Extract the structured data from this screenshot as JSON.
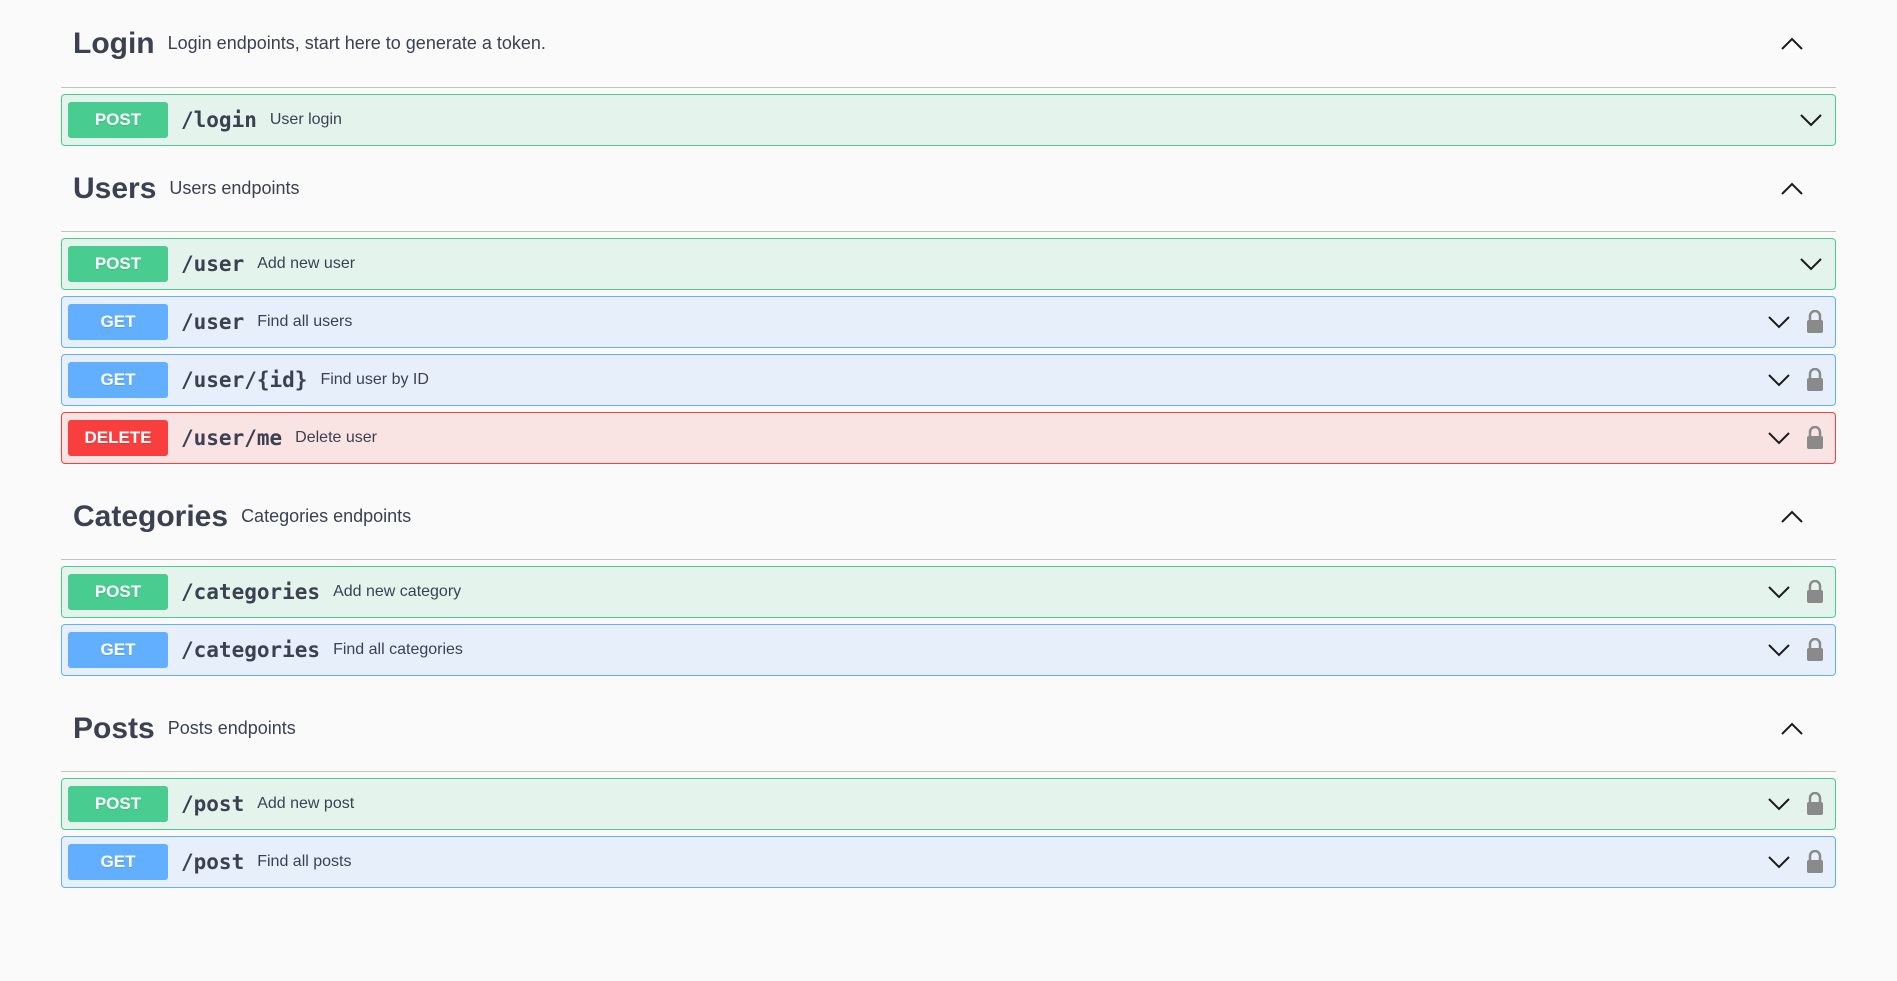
{
  "sections": [
    {
      "name": "Login",
      "description": "Login endpoints, start here to generate a token.",
      "operations": [
        {
          "method": "POST",
          "path": "/login",
          "summary": "User login",
          "locked": false
        }
      ]
    },
    {
      "name": "Users",
      "description": "Users endpoints",
      "operations": [
        {
          "method": "POST",
          "path": "/user",
          "summary": "Add new user",
          "locked": false
        },
        {
          "method": "GET",
          "path": "/user",
          "summary": "Find all users",
          "locked": true
        },
        {
          "method": "GET",
          "path": "/user/{id}",
          "summary": "Find user by ID",
          "locked": true
        },
        {
          "method": "DELETE",
          "path": "/user/me",
          "summary": "Delete user",
          "locked": true
        }
      ]
    },
    {
      "name": "Categories",
      "description": "Categories endpoints",
      "operations": [
        {
          "method": "POST",
          "path": "/categories",
          "summary": "Add new category",
          "locked": true
        },
        {
          "method": "GET",
          "path": "/categories",
          "summary": "Find all categories",
          "locked": true
        }
      ]
    },
    {
      "name": "Posts",
      "description": "Posts endpoints",
      "operations": [
        {
          "method": "POST",
          "path": "/post",
          "summary": "Add new post",
          "locked": true
        },
        {
          "method": "GET",
          "path": "/post",
          "summary": "Find all posts",
          "locked": true
        }
      ]
    }
  ],
  "colors": {
    "post": "#49cc90",
    "get": "#61affe",
    "delete": "#f93e3e",
    "text": "#3b4151",
    "lock": "#8a8a8a"
  },
  "icons": {
    "section_toggle": "chevron-up-icon",
    "operation_toggle": "chevron-down-icon",
    "auth": "lock-icon"
  }
}
